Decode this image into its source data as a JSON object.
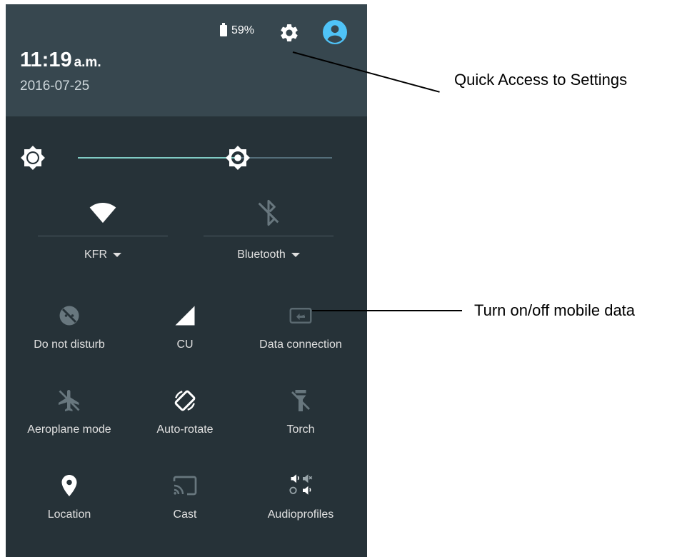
{
  "status": {
    "time": "11:19",
    "ampm": "a.m.",
    "date": "2016-07-25",
    "battery": "59%",
    "settings_icon": "gear-icon",
    "account_icon": "account-circle-icon"
  },
  "brightness": {
    "level": 0.63,
    "icon": "brightness-icon"
  },
  "big_tiles": [
    {
      "label": "KFR",
      "icon": "wifi-icon",
      "active": true
    },
    {
      "label": "Bluetooth",
      "icon": "bluetooth-off-icon",
      "active": false
    }
  ],
  "tiles": [
    {
      "label": "Do not disturb",
      "icon": "do-not-disturb-icon",
      "active": false
    },
    {
      "label": "CU",
      "icon": "signal-icon",
      "active": true
    },
    {
      "label": "Data connection",
      "icon": "data-connection-icon",
      "active": false
    },
    {
      "label": "Aeroplane mode",
      "icon": "airplane-icon",
      "active": false
    },
    {
      "label": "Auto-rotate",
      "icon": "auto-rotate-icon",
      "active": true
    },
    {
      "label": "Torch",
      "icon": "torch-icon",
      "active": false
    },
    {
      "label": "Location",
      "icon": "location-icon",
      "active": true
    },
    {
      "label": "Cast",
      "icon": "cast-icon",
      "active": false
    },
    {
      "label": "Audioprofiles",
      "icon": "audio-profiles-icon",
      "active": true
    }
  ],
  "annotations": {
    "settings": "Quick Access to Settings",
    "mobile_data": "Turn on/off mobile data"
  },
  "colors": {
    "panel": "#263238",
    "header": "#37474f",
    "accent": "#80cbc4",
    "icon_active": "#ffffff",
    "icon_inactive": "#68777e"
  }
}
